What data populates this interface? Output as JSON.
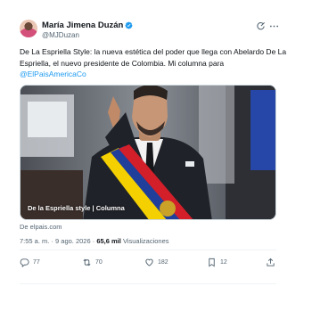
{
  "author": {
    "name": "María Jimena Duzán",
    "handle": "@MJDuzan",
    "verified_color": "#1d9bf0"
  },
  "tweet": {
    "text": "De La Espriella Style: la nueva estética  del poder que llega  con Abelardo De La Espriella, el nuevo presidente de Colombia.  Mi columna para ",
    "mention": "@ElPaisAmericaCo"
  },
  "media": {
    "caption": "De la Espriella style | Columna",
    "source": "De elpais.com"
  },
  "meta": {
    "time": "7:55 a. m.",
    "separator": " · ",
    "date": "9 ago. 2026",
    "separator2": " · ",
    "views_count": "65,6 mil",
    "views_label": " Visualizaciones"
  },
  "actions": {
    "replies": "77",
    "reposts": "70",
    "likes": "182",
    "bookmarks": "12"
  },
  "icons": [
    "verified-icon",
    "grok-icon",
    "more-icon",
    "reply-icon",
    "repost-icon",
    "like-icon",
    "bookmark-icon",
    "share-icon"
  ],
  "colors": {
    "accent": "#1d9bf0",
    "text": "#0f1419",
    "secondary": "#536471",
    "sash_yellow": "#f4d000",
    "sash_blue": "#1f3f9a",
    "sash_red": "#d21f2a"
  }
}
